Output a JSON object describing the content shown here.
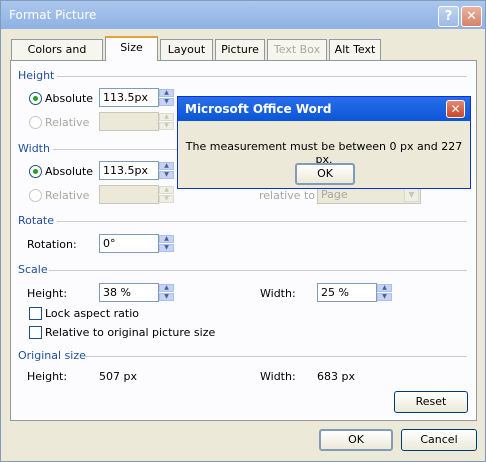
{
  "window": {
    "title": "Format Picture",
    "help_icon": "?",
    "close_icon": "✕"
  },
  "tabs": [
    {
      "label": "Colors and Lines",
      "active": false,
      "enabled": true
    },
    {
      "label": "Size",
      "active": true,
      "enabled": true
    },
    {
      "label": "Layout",
      "active": false,
      "enabled": true
    },
    {
      "label": "Picture",
      "active": false,
      "enabled": true
    },
    {
      "label": "Text Box",
      "active": false,
      "enabled": false
    },
    {
      "label": "Alt Text",
      "active": false,
      "enabled": true
    }
  ],
  "height": {
    "section": "Height",
    "absolute_label": "Absolute",
    "absolute_value": "113.5px",
    "relative_label": "Relative"
  },
  "width": {
    "section": "Width",
    "absolute_label": "Absolute",
    "absolute_value": "113.5px",
    "relative_label": "Relative",
    "relative_to_label": "relative to",
    "relative_to_value": "Page"
  },
  "rotate": {
    "section": "Rotate",
    "label": "Rotation:",
    "value": "0°"
  },
  "scale": {
    "section": "Scale",
    "height_label": "Height:",
    "height_value": "38 %",
    "width_label": "Width:",
    "width_value": "25 %",
    "lock_label": "Lock aspect ratio",
    "relative_label": "Relative to original picture size"
  },
  "original": {
    "section": "Original size",
    "height_label": "Height:",
    "height_value": "507 px",
    "width_label": "Width:",
    "width_value": "683 px"
  },
  "buttons": {
    "reset": "Reset",
    "ok": "OK",
    "cancel": "Cancel"
  },
  "message": {
    "title": "Microsoft Office Word",
    "text": "The measurement must be between 0 px and 227 px.",
    "ok": "OK",
    "close_icon": "✕"
  },
  "colors": {
    "accent_tab": "#e6a03c",
    "section_text": "#1e4e9e",
    "msg_title": "#0a55d8"
  }
}
